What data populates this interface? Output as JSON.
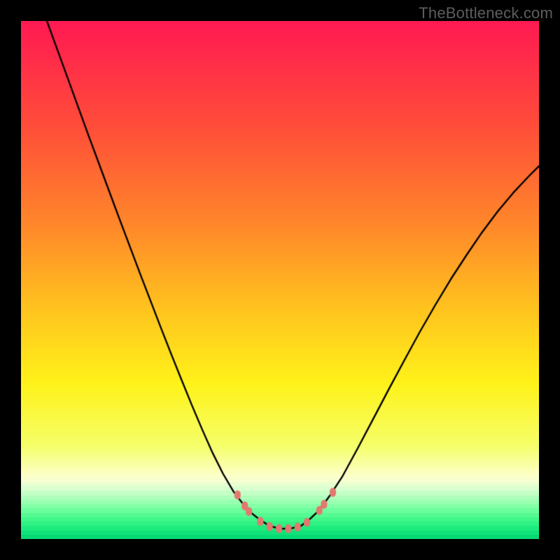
{
  "watermark": "TheBottleneck.com",
  "colors": {
    "frame": "#000000",
    "curve": "#000000",
    "marker_fill": "#e2796f",
    "marker_stroke": "#e2796f"
  },
  "chart_data": {
    "type": "line",
    "title": "",
    "xlabel": "",
    "ylabel": "",
    "xlim": [
      0,
      1
    ],
    "ylim": [
      0,
      1
    ],
    "gradient_stops": [
      {
        "pos": 0.0,
        "color": "#ff1a52"
      },
      {
        "pos": 0.2,
        "color": "#ff4d3a"
      },
      {
        "pos": 0.4,
        "color": "#ff8a2a"
      },
      {
        "pos": 0.55,
        "color": "#ffc21f"
      },
      {
        "pos": 0.7,
        "color": "#fff31a"
      },
      {
        "pos": 0.82,
        "color": "#f6ff6a"
      },
      {
        "pos": 0.885,
        "color": "#fdffd2"
      },
      {
        "pos": 0.905,
        "color": "#d7ffd0"
      },
      {
        "pos": 0.925,
        "color": "#a6ffb8"
      },
      {
        "pos": 0.945,
        "color": "#70ff9e"
      },
      {
        "pos": 0.965,
        "color": "#3cf788"
      },
      {
        "pos": 0.985,
        "color": "#14e87c"
      },
      {
        "pos": 1.0,
        "color": "#05d873"
      }
    ],
    "series": [
      {
        "name": "bottleneck-curve",
        "x": [
          0.05,
          0.07,
          0.09,
          0.11,
          0.13,
          0.15,
          0.17,
          0.19,
          0.21,
          0.23,
          0.25,
          0.27,
          0.29,
          0.31,
          0.33,
          0.35,
          0.37,
          0.39,
          0.41,
          0.43,
          0.445,
          0.46,
          0.48,
          0.5,
          0.52,
          0.54,
          0.555,
          0.575,
          0.595,
          0.62,
          0.65,
          0.68,
          0.71,
          0.74,
          0.77,
          0.8,
          0.83,
          0.86,
          0.89,
          0.92,
          0.95,
          0.98,
          1.0
        ],
        "y": [
          1.0,
          0.945,
          0.89,
          0.835,
          0.78,
          0.726,
          0.672,
          0.618,
          0.565,
          0.512,
          0.46,
          0.408,
          0.357,
          0.307,
          0.258,
          0.211,
          0.166,
          0.126,
          0.092,
          0.066,
          0.05,
          0.038,
          0.025,
          0.02,
          0.02,
          0.025,
          0.036,
          0.055,
          0.082,
          0.12,
          0.175,
          0.232,
          0.289,
          0.345,
          0.4,
          0.452,
          0.502,
          0.548,
          0.592,
          0.632,
          0.668,
          0.7,
          0.72
        ]
      }
    ],
    "markers": [
      {
        "x": 0.418,
        "y": 0.085
      },
      {
        "x": 0.432,
        "y": 0.064
      },
      {
        "x": 0.44,
        "y": 0.053
      },
      {
        "x": 0.462,
        "y": 0.034
      },
      {
        "x": 0.48,
        "y": 0.024
      },
      {
        "x": 0.498,
        "y": 0.02
      },
      {
        "x": 0.516,
        "y": 0.02
      },
      {
        "x": 0.534,
        "y": 0.023
      },
      {
        "x": 0.552,
        "y": 0.032
      },
      {
        "x": 0.576,
        "y": 0.055
      },
      {
        "x": 0.585,
        "y": 0.067
      },
      {
        "x": 0.602,
        "y": 0.09
      }
    ]
  }
}
